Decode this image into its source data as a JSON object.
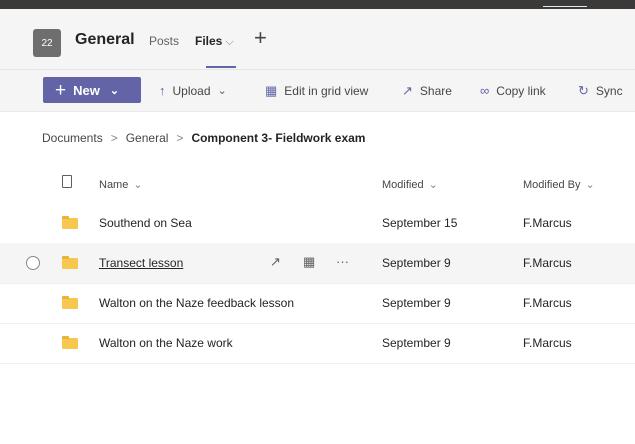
{
  "header": {
    "team_avatar": "22",
    "channel_name": "General",
    "tabs": [
      {
        "label": "Posts"
      },
      {
        "label": "Files",
        "chevron": "⌵"
      }
    ],
    "add_tab": "+"
  },
  "toolbar": {
    "new_label": "New",
    "upload_label": "Upload",
    "edit_grid_label": "Edit in grid view",
    "share_label": "Share",
    "copy_link_label": "Copy link",
    "sync_label": "Sync"
  },
  "breadcrumb": {
    "items": [
      "Documents",
      "General",
      "Component 3- Fieldwork exam"
    ]
  },
  "list": {
    "columns": {
      "name": "Name",
      "modified": "Modified",
      "modified_by": "Modified By"
    },
    "rows": [
      {
        "name": "Southend on Sea",
        "modified": "September 15",
        "modified_by": "F.Marcus"
      },
      {
        "name": "Transect lesson",
        "modified": "September 9",
        "modified_by": "F.Marcus"
      },
      {
        "name": "Walton on the Naze feedback lesson",
        "modified": "September 9",
        "modified_by": "F.Marcus"
      },
      {
        "name": "Walton on the Naze work",
        "modified": "September 9",
        "modified_by": "F.Marcus"
      }
    ],
    "more_actions": "···"
  },
  "colors": {
    "accent": "#6264a7",
    "folder": "#f8c74f",
    "header_bg": "#f5f5f5"
  },
  "icons": [
    "upload-icon",
    "grid-icon",
    "share-icon",
    "link-icon",
    "sync-icon",
    "folder-icon",
    "document-icon"
  ]
}
